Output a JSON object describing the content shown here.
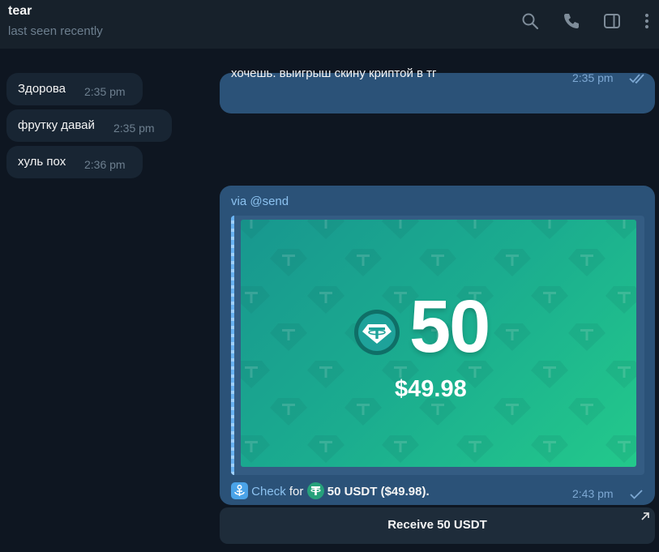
{
  "header": {
    "peer_name": "tear",
    "peer_status": "last seen recently",
    "icons": [
      "search-icon",
      "phone-icon",
      "sidebar-toggle-icon",
      "more-menu-icon"
    ]
  },
  "messages": {
    "top_outgoing": {
      "partial_text": "хочешь. выигрыш скину криптой в тг",
      "time": "2:35 pm",
      "status": "read"
    },
    "incoming": [
      {
        "text": "Здорова",
        "time": "2:35 pm"
      },
      {
        "text": "фрутку давай",
        "time": "2:35 pm"
      },
      {
        "text": "хуль пох",
        "time": "2:36 pm"
      }
    ],
    "check": {
      "via": "via @send",
      "amount_big": "50",
      "amount_usd": "$49.98",
      "caption_link": "Check",
      "caption_for": "for",
      "caption_amount": "50 USDT ($49.98).",
      "time": "2:43 pm",
      "status": "sent"
    },
    "inline_button": {
      "label": "Receive 50 USDT"
    }
  },
  "colors": {
    "background": "#0e1621",
    "header": "#17212b",
    "bubble_in": "#182533",
    "bubble_out": "#2b5278",
    "accent": "#8cc2f0",
    "card_gradient_start": "#18978f",
    "card_gradient_end": "#23c98b"
  }
}
